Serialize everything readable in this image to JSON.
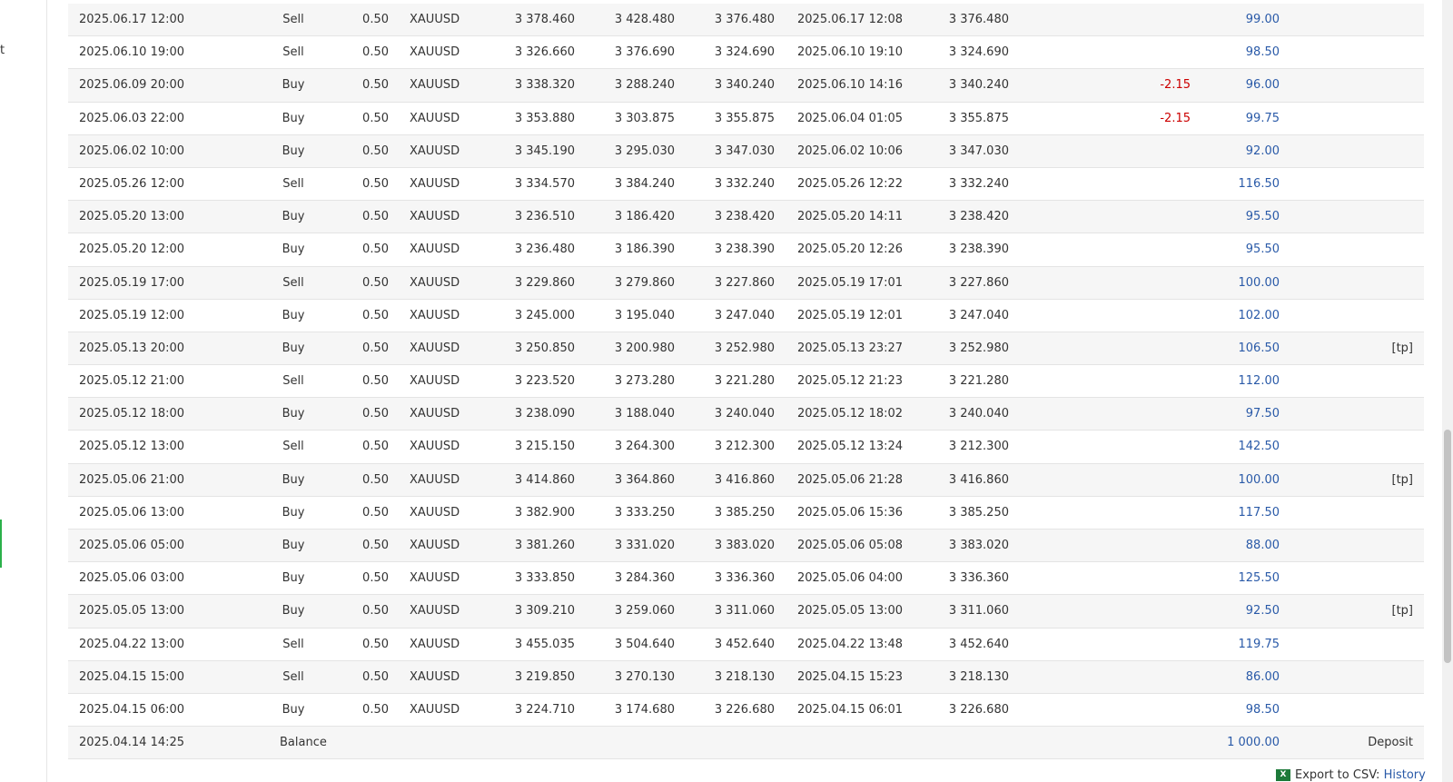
{
  "sidebar": {
    "partial_text": "t"
  },
  "rows": [
    {
      "time": "2025.06.17 12:00",
      "type": "Sell",
      "volume": "0.50",
      "symbol": "XAUUSD",
      "open": "3 378.460",
      "sl": "3 428.480",
      "tp": "3 376.480",
      "close_time": "2025.06.17 12:08",
      "close": "3 376.480",
      "swap": "",
      "profit": "99.00",
      "comment": ""
    },
    {
      "time": "2025.06.10 19:00",
      "type": "Sell",
      "volume": "0.50",
      "symbol": "XAUUSD",
      "open": "3 326.660",
      "sl": "3 376.690",
      "tp": "3 324.690",
      "close_time": "2025.06.10 19:10",
      "close": "3 324.690",
      "swap": "",
      "profit": "98.50",
      "comment": ""
    },
    {
      "time": "2025.06.09 20:00",
      "type": "Buy",
      "volume": "0.50",
      "symbol": "XAUUSD",
      "open": "3 338.320",
      "sl": "3 288.240",
      "tp": "3 340.240",
      "close_time": "2025.06.10 14:16",
      "close": "3 340.240",
      "swap": "-2.15",
      "profit": "96.00",
      "comment": ""
    },
    {
      "time": "2025.06.03 22:00",
      "type": "Buy",
      "volume": "0.50",
      "symbol": "XAUUSD",
      "open": "3 353.880",
      "sl": "3 303.875",
      "tp": "3 355.875",
      "close_time": "2025.06.04 01:05",
      "close": "3 355.875",
      "swap": "-2.15",
      "profit": "99.75",
      "comment": ""
    },
    {
      "time": "2025.06.02 10:00",
      "type": "Buy",
      "volume": "0.50",
      "symbol": "XAUUSD",
      "open": "3 345.190",
      "sl": "3 295.030",
      "tp": "3 347.030",
      "close_time": "2025.06.02 10:06",
      "close": "3 347.030",
      "swap": "",
      "profit": "92.00",
      "comment": ""
    },
    {
      "time": "2025.05.26 12:00",
      "type": "Sell",
      "volume": "0.50",
      "symbol": "XAUUSD",
      "open": "3 334.570",
      "sl": "3 384.240",
      "tp": "3 332.240",
      "close_time": "2025.05.26 12:22",
      "close": "3 332.240",
      "swap": "",
      "profit": "116.50",
      "comment": ""
    },
    {
      "time": "2025.05.20 13:00",
      "type": "Buy",
      "volume": "0.50",
      "symbol": "XAUUSD",
      "open": "3 236.510",
      "sl": "3 186.420",
      "tp": "3 238.420",
      "close_time": "2025.05.20 14:11",
      "close": "3 238.420",
      "swap": "",
      "profit": "95.50",
      "comment": ""
    },
    {
      "time": "2025.05.20 12:00",
      "type": "Buy",
      "volume": "0.50",
      "symbol": "XAUUSD",
      "open": "3 236.480",
      "sl": "3 186.390",
      "tp": "3 238.390",
      "close_time": "2025.05.20 12:26",
      "close": "3 238.390",
      "swap": "",
      "profit": "95.50",
      "comment": ""
    },
    {
      "time": "2025.05.19 17:00",
      "type": "Sell",
      "volume": "0.50",
      "symbol": "XAUUSD",
      "open": "3 229.860",
      "sl": "3 279.860",
      "tp": "3 227.860",
      "close_time": "2025.05.19 17:01",
      "close": "3 227.860",
      "swap": "",
      "profit": "100.00",
      "comment": ""
    },
    {
      "time": "2025.05.19 12:00",
      "type": "Buy",
      "volume": "0.50",
      "symbol": "XAUUSD",
      "open": "3 245.000",
      "sl": "3 195.040",
      "tp": "3 247.040",
      "close_time": "2025.05.19 12:01",
      "close": "3 247.040",
      "swap": "",
      "profit": "102.00",
      "comment": ""
    },
    {
      "time": "2025.05.13 20:00",
      "type": "Buy",
      "volume": "0.50",
      "symbol": "XAUUSD",
      "open": "3 250.850",
      "sl": "3 200.980",
      "tp": "3 252.980",
      "close_time": "2025.05.13 23:27",
      "close": "3 252.980",
      "swap": "",
      "profit": "106.50",
      "comment": "[tp]"
    },
    {
      "time": "2025.05.12 21:00",
      "type": "Sell",
      "volume": "0.50",
      "symbol": "XAUUSD",
      "open": "3 223.520",
      "sl": "3 273.280",
      "tp": "3 221.280",
      "close_time": "2025.05.12 21:23",
      "close": "3 221.280",
      "swap": "",
      "profit": "112.00",
      "comment": ""
    },
    {
      "time": "2025.05.12 18:00",
      "type": "Buy",
      "volume": "0.50",
      "symbol": "XAUUSD",
      "open": "3 238.090",
      "sl": "3 188.040",
      "tp": "3 240.040",
      "close_time": "2025.05.12 18:02",
      "close": "3 240.040",
      "swap": "",
      "profit": "97.50",
      "comment": ""
    },
    {
      "time": "2025.05.12 13:00",
      "type": "Sell",
      "volume": "0.50",
      "symbol": "XAUUSD",
      "open": "3 215.150",
      "sl": "3 264.300",
      "tp": "3 212.300",
      "close_time": "2025.05.12 13:24",
      "close": "3 212.300",
      "swap": "",
      "profit": "142.50",
      "comment": ""
    },
    {
      "time": "2025.05.06 21:00",
      "type": "Buy",
      "volume": "0.50",
      "symbol": "XAUUSD",
      "open": "3 414.860",
      "sl": "3 364.860",
      "tp": "3 416.860",
      "close_time": "2025.05.06 21:28",
      "close": "3 416.860",
      "swap": "",
      "profit": "100.00",
      "comment": "[tp]"
    },
    {
      "time": "2025.05.06 13:00",
      "type": "Buy",
      "volume": "0.50",
      "symbol": "XAUUSD",
      "open": "3 382.900",
      "sl": "3 333.250",
      "tp": "3 385.250",
      "close_time": "2025.05.06 15:36",
      "close": "3 385.250",
      "swap": "",
      "profit": "117.50",
      "comment": ""
    },
    {
      "time": "2025.05.06 05:00",
      "type": "Buy",
      "volume": "0.50",
      "symbol": "XAUUSD",
      "open": "3 381.260",
      "sl": "3 331.020",
      "tp": "3 383.020",
      "close_time": "2025.05.06 05:08",
      "close": "3 383.020",
      "swap": "",
      "profit": "88.00",
      "comment": ""
    },
    {
      "time": "2025.05.06 03:00",
      "type": "Buy",
      "volume": "0.50",
      "symbol": "XAUUSD",
      "open": "3 333.850",
      "sl": "3 284.360",
      "tp": "3 336.360",
      "close_time": "2025.05.06 04:00",
      "close": "3 336.360",
      "swap": "",
      "profit": "125.50",
      "comment": ""
    },
    {
      "time": "2025.05.05 13:00",
      "type": "Buy",
      "volume": "0.50",
      "symbol": "XAUUSD",
      "open": "3 309.210",
      "sl": "3 259.060",
      "tp": "3 311.060",
      "close_time": "2025.05.05 13:00",
      "close": "3 311.060",
      "swap": "",
      "profit": "92.50",
      "comment": "[tp]"
    },
    {
      "time": "2025.04.22 13:00",
      "type": "Sell",
      "volume": "0.50",
      "symbol": "XAUUSD",
      "open": "3 455.035",
      "sl": "3 504.640",
      "tp": "3 452.640",
      "close_time": "2025.04.22 13:48",
      "close": "3 452.640",
      "swap": "",
      "profit": "119.75",
      "comment": ""
    },
    {
      "time": "2025.04.15 15:00",
      "type": "Sell",
      "volume": "0.50",
      "symbol": "XAUUSD",
      "open": "3 219.850",
      "sl": "3 270.130",
      "tp": "3 218.130",
      "close_time": "2025.04.15 15:23",
      "close": "3 218.130",
      "swap": "",
      "profit": "86.00",
      "comment": ""
    },
    {
      "time": "2025.04.15 06:00",
      "type": "Buy",
      "volume": "0.50",
      "symbol": "XAUUSD",
      "open": "3 224.710",
      "sl": "3 174.680",
      "tp": "3 226.680",
      "close_time": "2025.04.15 06:01",
      "close": "3 226.680",
      "swap": "",
      "profit": "98.50",
      "comment": ""
    },
    {
      "time": "2025.04.14 14:25",
      "type": "Balance",
      "volume": "",
      "symbol": "",
      "open": "",
      "sl": "",
      "tp": "",
      "close_time": "",
      "close": "",
      "swap": "",
      "profit": "1 000.00",
      "comment": "Deposit"
    }
  ],
  "export": {
    "icon": "excel-icon",
    "label": "Export to CSV:",
    "link": "History"
  },
  "colors": {
    "profit": "#2a5aa8",
    "swap_negative": "#cc0000",
    "row_alt": "#f6f6f6"
  }
}
